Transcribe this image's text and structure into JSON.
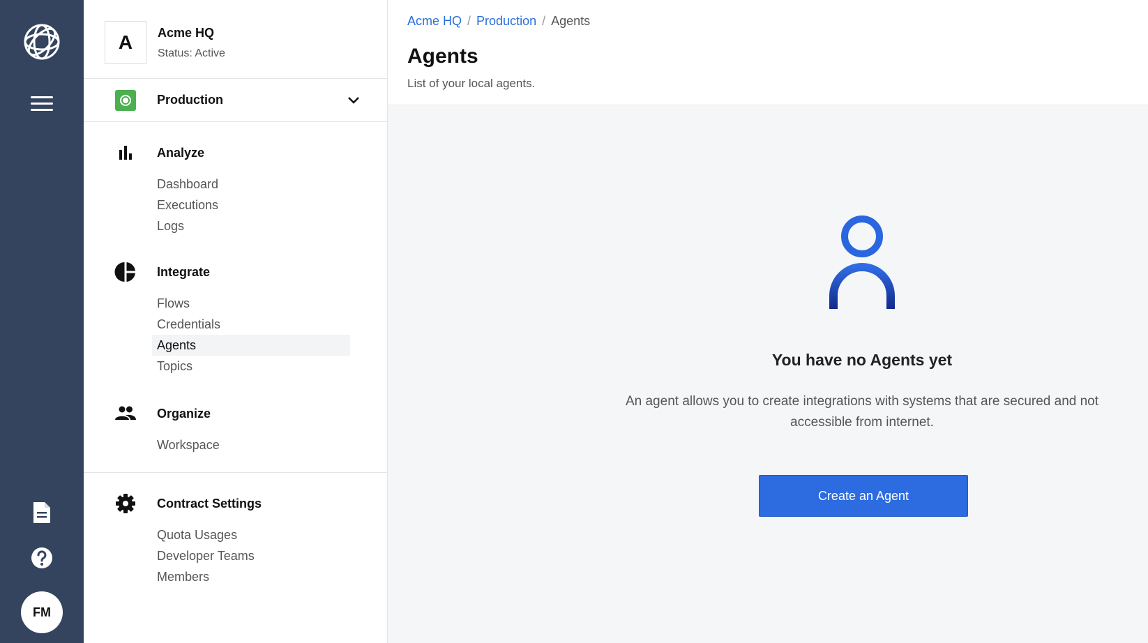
{
  "rail": {
    "avatar_initials": "FM"
  },
  "org": {
    "initial": "A",
    "name": "Acme HQ",
    "status": "Status: Active"
  },
  "environment": {
    "label": "Production"
  },
  "nav": {
    "analyze": {
      "title": "Analyze",
      "items": [
        "Dashboard",
        "Executions",
        "Logs"
      ]
    },
    "integrate": {
      "title": "Integrate",
      "items": [
        "Flows",
        "Credentials",
        "Agents",
        "Topics"
      ],
      "active": "Agents"
    },
    "organize": {
      "title": "Organize",
      "items": [
        "Workspace"
      ]
    },
    "contract": {
      "title": "Contract Settings",
      "items": [
        "Quota Usages",
        "Developer Teams",
        "Members"
      ]
    }
  },
  "breadcrumb": {
    "items": [
      "Acme HQ",
      "Production"
    ],
    "current": "Agents"
  },
  "page": {
    "title": "Agents",
    "subtitle": "List of your local agents."
  },
  "empty_state": {
    "heading": "You have no Agents yet",
    "description": "An agent allows you to create integrations with systems that are secured and not accessible from internet.",
    "cta": "Create an Agent"
  },
  "colors": {
    "rail_bg": "#34445f",
    "accent": "#2c6be0",
    "environment": "#4caf50"
  }
}
